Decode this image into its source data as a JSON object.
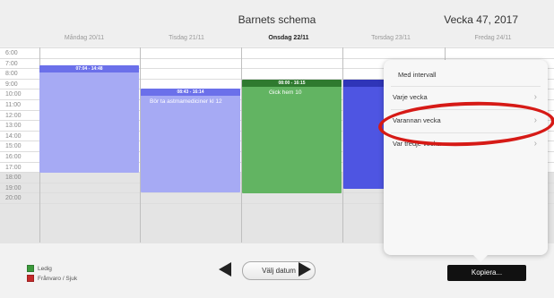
{
  "header": {
    "title": "Barnets schema",
    "week": "Vecka 47, 2017"
  },
  "days": [
    {
      "label": "Måndag 20/11"
    },
    {
      "label": "Tisdag 21/11"
    },
    {
      "label": "Onsdag 22/11"
    },
    {
      "label": "Torsdag 23/11"
    },
    {
      "label": "Fredag 24/11"
    }
  ],
  "hours": [
    "6:00",
    "7:00",
    "8:00",
    "9:00",
    "10:00",
    "11:00",
    "12:00",
    "13:00",
    "14:00",
    "15:00",
    "16:00",
    "17:00",
    "18:00",
    "19:00",
    "20:00"
  ],
  "events": [
    {
      "time": "07:04 - 14:48",
      "note": ""
    },
    {
      "time": "08:43 - 16:14",
      "note": "Bör ta astmamediciner kl 12"
    },
    {
      "time": "08:00 - 16:15",
      "note": "Gick hem 10"
    }
  ],
  "legend": [
    {
      "label": "Ledig",
      "color": "#3c9a3c"
    },
    {
      "label": "Frånvaro / Sjuk",
      "color": "#c52a2a"
    }
  ],
  "nav": {
    "date_button": "Välj datum",
    "copy_button": "Kopiera..."
  },
  "popover": {
    "title": "Med intervall",
    "items": [
      {
        "label": "Varje vecka"
      },
      {
        "label": "Varannan vecka"
      },
      {
        "label": "Var tredje vecka"
      }
    ]
  },
  "colors": {
    "blue_light": "#a6aaf4",
    "blue_dark": "#6b70ea",
    "blue_strong": "#4e55e2",
    "green": "#62b462",
    "green_dark": "#2f7a2f",
    "highlight": "#d61a16"
  }
}
